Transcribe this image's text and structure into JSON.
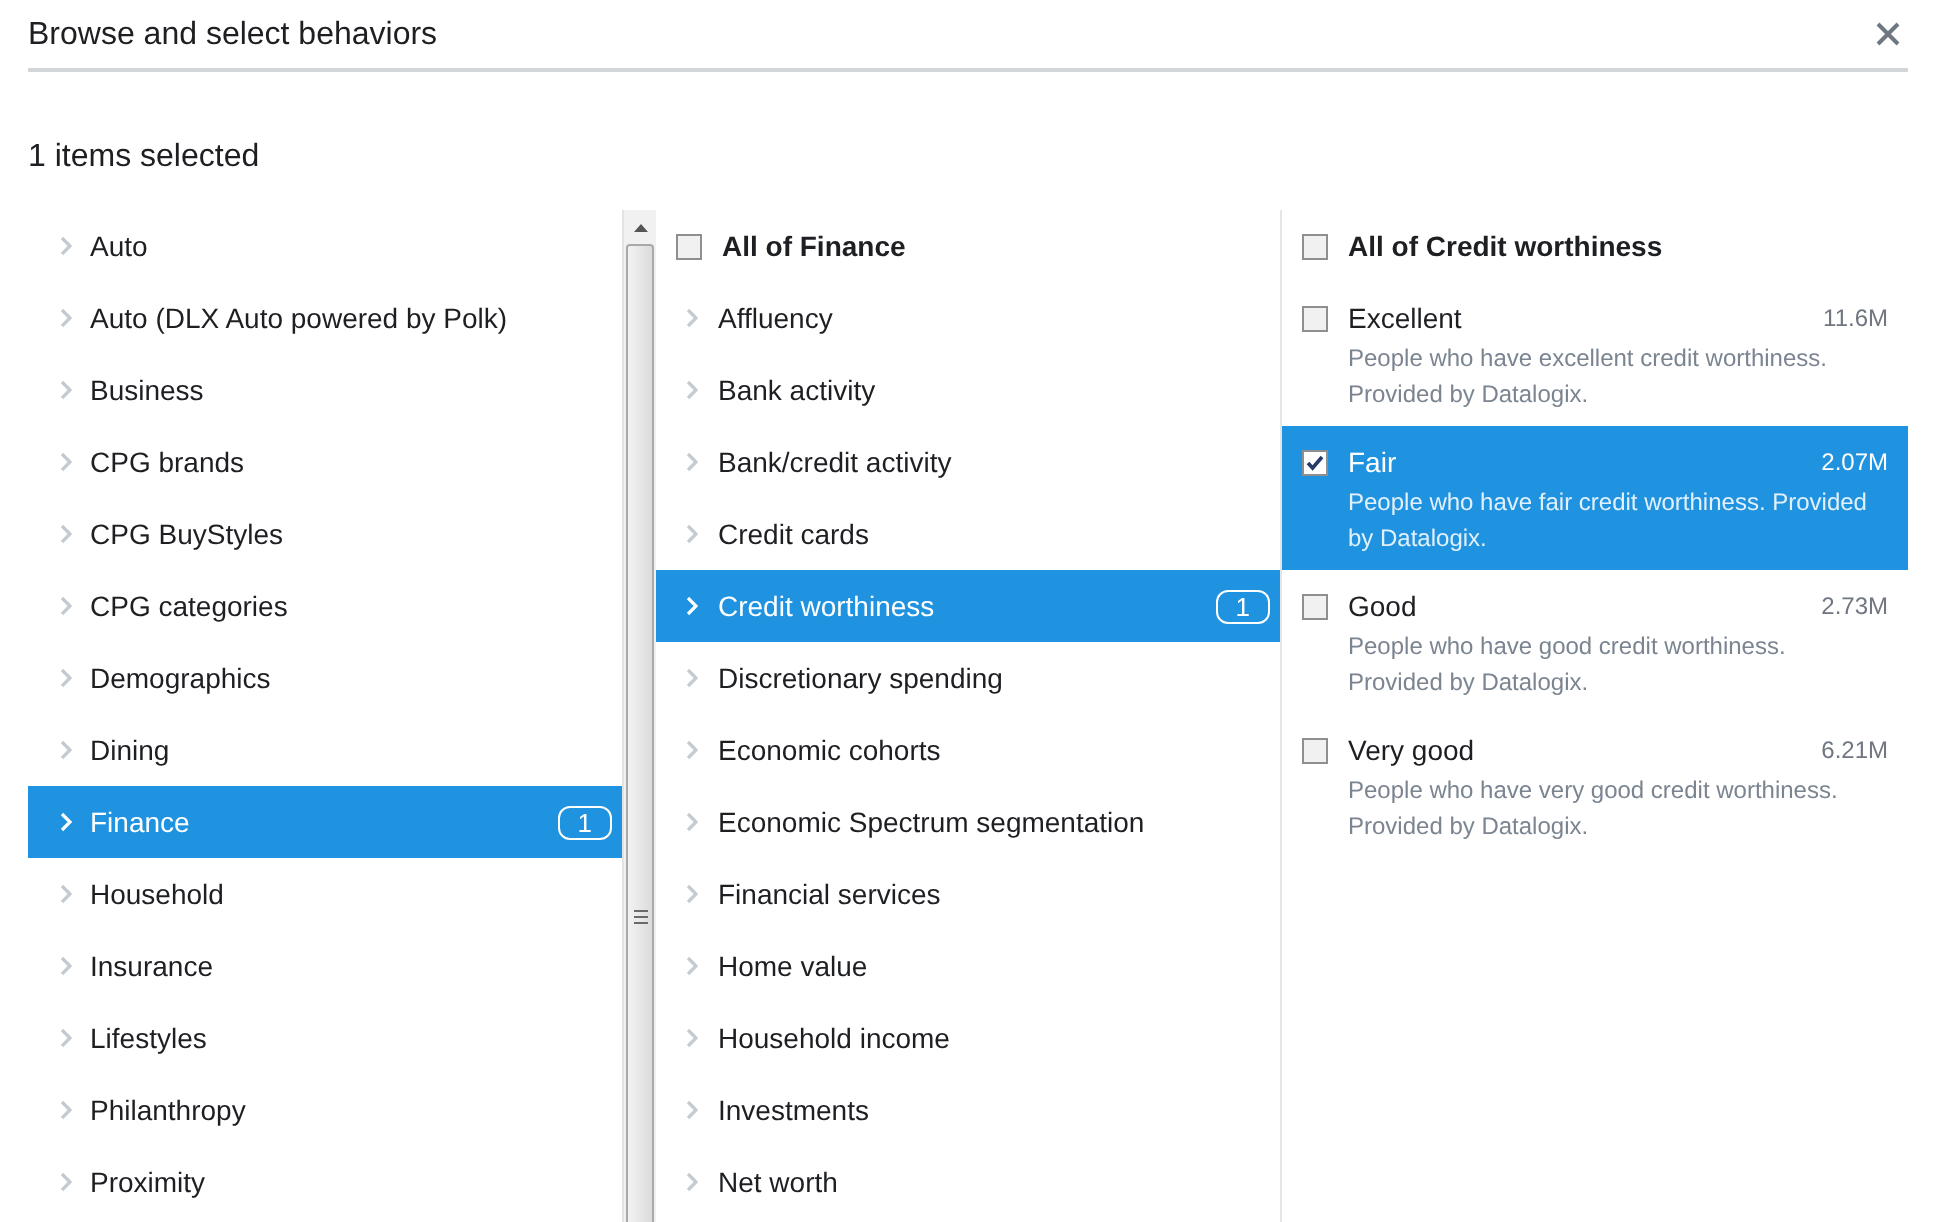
{
  "dialog": {
    "title": "Browse and select behaviors"
  },
  "selection_summary": "1 items selected",
  "categories": [
    {
      "label": "Auto",
      "selected": false
    },
    {
      "label": "Auto (DLX Auto powered by Polk)",
      "selected": false
    },
    {
      "label": "Business",
      "selected": false
    },
    {
      "label": "CPG brands",
      "selected": false
    },
    {
      "label": "CPG BuyStyles",
      "selected": false
    },
    {
      "label": "CPG categories",
      "selected": false
    },
    {
      "label": "Demographics",
      "selected": false
    },
    {
      "label": "Dining",
      "selected": false
    },
    {
      "label": "Finance",
      "selected": true,
      "count": "1"
    },
    {
      "label": "Household",
      "selected": false
    },
    {
      "label": "Insurance",
      "selected": false
    },
    {
      "label": "Lifestyles",
      "selected": false
    },
    {
      "label": "Philanthropy",
      "selected": false
    },
    {
      "label": "Proximity",
      "selected": false
    }
  ],
  "subcategories": {
    "select_all": {
      "label": "All of Finance",
      "checked": false
    },
    "items": [
      {
        "label": "Affluency",
        "selected": false
      },
      {
        "label": "Bank activity",
        "selected": false
      },
      {
        "label": "Bank/credit activity",
        "selected": false
      },
      {
        "label": "Credit cards",
        "selected": false
      },
      {
        "label": "Credit worthiness",
        "selected": true,
        "count": "1"
      },
      {
        "label": "Discretionary spending",
        "selected": false
      },
      {
        "label": "Economic cohorts",
        "selected": false
      },
      {
        "label": "Economic Spectrum segmentation",
        "selected": false
      },
      {
        "label": "Financial services",
        "selected": false
      },
      {
        "label": "Home value",
        "selected": false
      },
      {
        "label": "Household income",
        "selected": false
      },
      {
        "label": "Investments",
        "selected": false
      },
      {
        "label": "Net worth",
        "selected": false
      }
    ]
  },
  "options": {
    "select_all": {
      "label": "All of Credit worthiness",
      "checked": false
    },
    "items": [
      {
        "label": "Excellent",
        "size": "11.6M",
        "description": "People who have excellent credit worthiness. Provided by Datalogix.",
        "checked": false
      },
      {
        "label": "Fair",
        "size": "2.07M",
        "description": "People who have fair credit worthiness. Provided by Datalogix.",
        "checked": true
      },
      {
        "label": "Good",
        "size": "2.73M",
        "description": "People who have good credit worthiness. Provided by Datalogix.",
        "checked": false
      },
      {
        "label": "Very good",
        "size": "6.21M",
        "description": "People who have very good credit worthiness. Provided by Datalogix.",
        "checked": false
      }
    ]
  }
}
